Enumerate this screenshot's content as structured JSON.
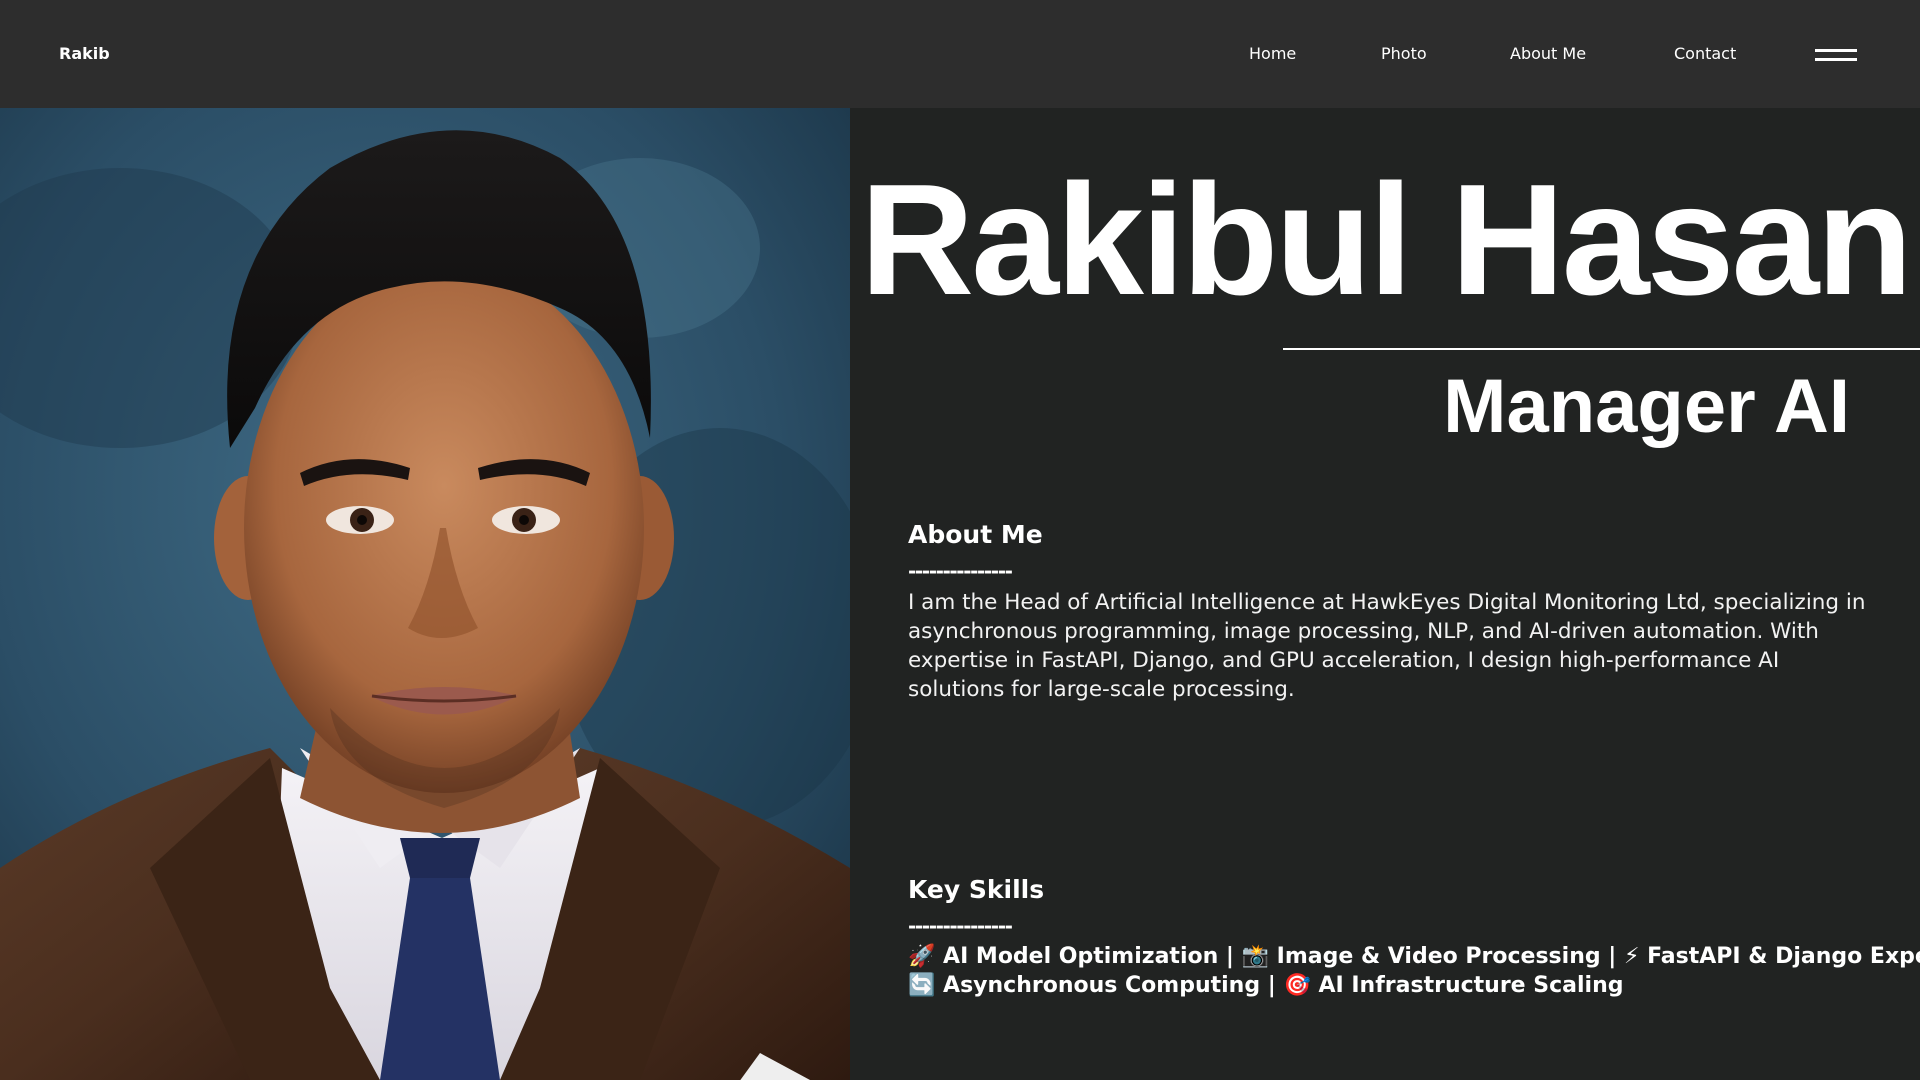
{
  "header": {
    "brand": "Rakib",
    "nav": [
      "Home",
      "Photo",
      "About Me",
      "Contact"
    ]
  },
  "hero": {
    "name": "Rakibul Hasan",
    "role": "Manager AI",
    "photo_alt": "portrait-photo"
  },
  "about": {
    "heading": "About Me",
    "divider": "---------------",
    "text": "I am the Head of Artificial Intelligence at HawkEyes Digital Monitoring Ltd, specializing in asynchronous programming, image processing, NLP, and AI-driven automation. With expertise in FastAPI, Django, and GPU acceleration, I design high-performance AI solutions for large-scale processing."
  },
  "skills": {
    "heading": "Key Skills",
    "divider": "---------------",
    "line1": "🚀 AI Model Optimization | 📸 Image & Video Processing | ⚡ FastAPI & Django Expert",
    "line2": "🔄 Asynchronous Computing | 🎯 AI Infrastructure Scaling"
  },
  "colors": {
    "page_background": "#212322",
    "navbar_background": "#2d2d2d",
    "text": "#ffffff"
  },
  "icons": {
    "menu": "hamburger-menu-icon"
  }
}
